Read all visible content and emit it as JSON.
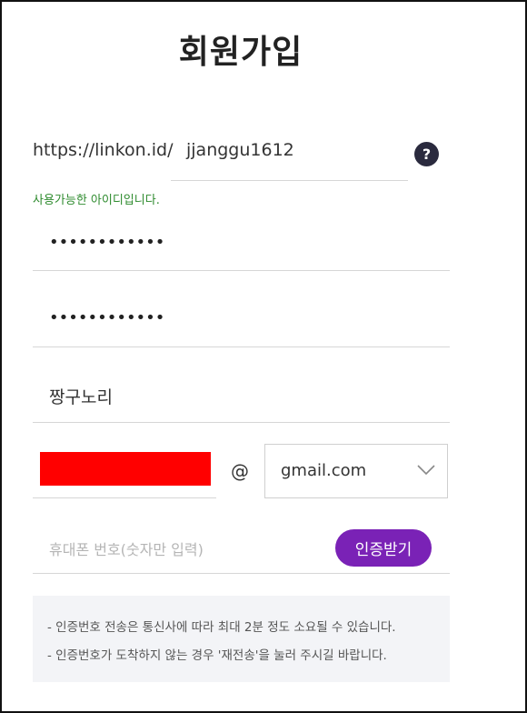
{
  "page": {
    "title": "회원가입"
  },
  "id_field": {
    "prefix": "https://linkon.id/",
    "value": "jjanggu1612",
    "help_icon": "question-mark-icon",
    "help_glyph": "?",
    "status_message": "사용가능한 아이디입니다.",
    "status_color": "#2e8b2e"
  },
  "password_field": {
    "masked_value": "••••••••••••"
  },
  "password_confirm_field": {
    "masked_value": "••••••••••••"
  },
  "nickname_field": {
    "value": "짱구노리"
  },
  "email": {
    "at_symbol": "@",
    "domain_selected": "gmail.com",
    "redaction_color": "#ff0000"
  },
  "phone": {
    "placeholder": "휴대폰 번호(숫자만 입력)",
    "verify_button_label": "인증받기",
    "verify_button_color": "#7a22b6"
  },
  "notice": {
    "lines": [
      "- 인증번호 전송은 통신사에 따라 최대 2분 정도 소요될 수 있습니다.",
      "- 인증번호가 도착하지 않는 경우 '재전송'을 눌러 주시길 바랍니다."
    ]
  }
}
